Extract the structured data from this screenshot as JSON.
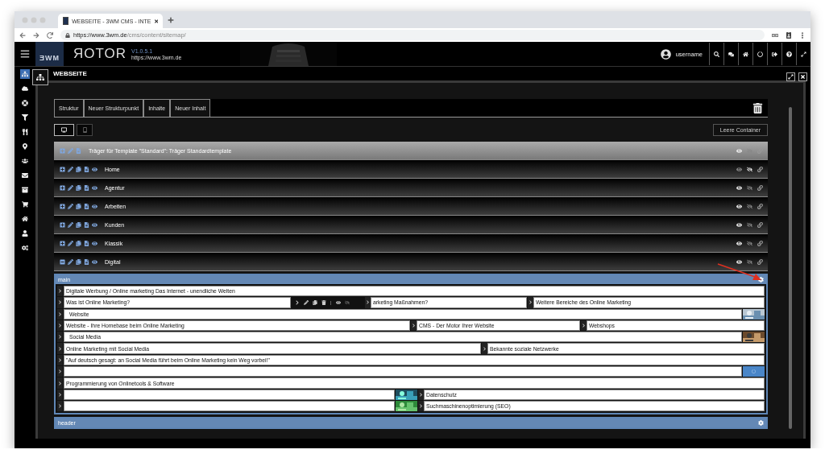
{
  "browser": {
    "tab_title": "WEBSEITE - 3WM CMS - INTE",
    "url_host": "https://www.3wm.de",
    "url_path": "/cms/content/sitemap/"
  },
  "app": {
    "logo": "ƎWM",
    "brand": "ЯOTOR",
    "version": "V1.0.5.1",
    "site": "https://www.3wm.de",
    "username": "username"
  },
  "sidebar": {
    "items": [
      {
        "selected": true
      },
      {
        "selected": false
      },
      {
        "selected": false
      },
      {
        "selected": false
      },
      {
        "selected": false
      },
      {
        "selected": false
      },
      {
        "selected": false
      },
      {
        "selected": false
      },
      {
        "selected": false
      },
      {
        "selected": false
      },
      {
        "selected": false
      },
      {
        "selected": false
      },
      {
        "selected": false
      }
    ]
  },
  "page_title": "WEBSEITE",
  "toolbar_buttons": [
    "Struktur",
    "Neuer Strukturpunkt",
    "Inhalte",
    "Neuer Inhalt"
  ],
  "view_modes": [
    {
      "kind": "desktop",
      "selected": true
    },
    {
      "kind": "mobile",
      "selected": false
    }
  ],
  "clear_button": "Leere Container",
  "tree": [
    {
      "kind": "carrier",
      "label": "Träger für Template \"Standard\": Träger Standardtemplate",
      "expanded": false,
      "visible": true
    },
    {
      "kind": "page",
      "label": "Home",
      "expanded": false,
      "visible": false
    },
    {
      "kind": "page",
      "label": "Agentur",
      "expanded": false,
      "visible": true
    },
    {
      "kind": "page",
      "label": "Arbeiten",
      "expanded": false,
      "visible": true
    },
    {
      "kind": "page",
      "label": "Kunden",
      "expanded": false,
      "visible": true
    },
    {
      "kind": "page",
      "label": "Klassik",
      "expanded": false,
      "visible": true
    },
    {
      "kind": "page",
      "label": "Digital",
      "expanded": true,
      "visible": true
    }
  ],
  "containers": [
    {
      "name": "main",
      "elements": [
        {
          "parts": [
            {
              "kind": "text",
              "text": "Digitale Werbung / Online marketing Das Internet - unendliche Welten"
            }
          ]
        },
        {
          "parts": [
            {
              "kind": "text",
              "text": "Was ist Online Marketing?"
            },
            {
              "kind": "toolbar",
              "separator": "|"
            },
            {
              "kind": "text",
              "text": "arketing Maßnahmen?"
            },
            {
              "kind": "text",
              "text": "Weitere Bereiche des Online Marketing"
            }
          ]
        },
        {
          "parts": [
            {
              "kind": "text",
              "text": "Website"
            },
            {
              "kind": "picture"
            }
          ]
        },
        {
          "parts": [
            {
              "kind": "text",
              "text": "Website - Ihre Homebase beim Online Marketing"
            },
            {
              "kind": "text",
              "text": "CMS - Der Motor Ihrer Website"
            },
            {
              "kind": "text",
              "text": "Webshops"
            }
          ]
        },
        {
          "parts": [
            {
              "kind": "text",
              "text": "Social Media"
            },
            {
              "kind": "picture"
            }
          ]
        },
        {
          "parts": [
            {
              "kind": "text",
              "text": "Online Marketing mit Social Media"
            },
            {
              "kind": "text",
              "text": "Bekannte soziale Netzwerke"
            }
          ]
        },
        {
          "parts": [
            {
              "kind": "text",
              "text": "\"Auf deutsch gesagt: an Social Media führt beim Online Marketing kein Weg vorbei!\""
            }
          ]
        },
        {
          "parts": [
            {
              "kind": "blank"
            },
            {
              "kind": "button"
            }
          ]
        },
        {
          "parts": [
            {
              "kind": "text",
              "text": "Programmierung von Onlinetools & Software"
            }
          ]
        },
        {
          "parts": [
            {
              "kind": "blank"
            },
            {
              "kind": "picture"
            },
            {
              "kind": "text",
              "text": "Datenschutz"
            }
          ]
        },
        {
          "parts": [
            {
              "kind": "blank"
            },
            {
              "kind": "picture"
            },
            {
              "kind": "text",
              "text": "Suchmaschinenoptimierung (SEO)"
            }
          ]
        }
      ]
    },
    {
      "name": "header"
    }
  ]
}
